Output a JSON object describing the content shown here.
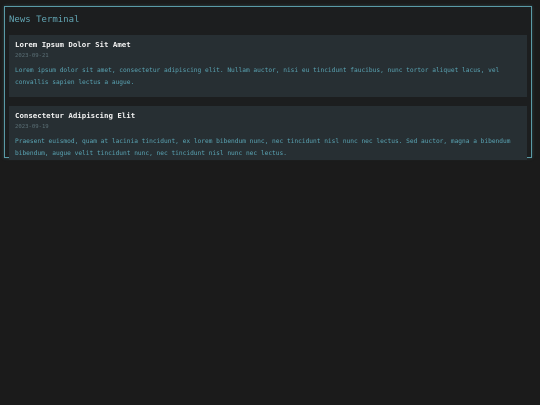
{
  "terminal": {
    "title": "News Terminal"
  },
  "articles": [
    {
      "title": "Lorem Ipsum Dolor Sit Amet",
      "date": "2023-09-21",
      "body": "Lorem ipsum dolor sit amet, consectetur adipiscing elit. Nullam auctor, nisi eu tincidunt faucibus, nunc tortor aliquet lacus, vel convallis sapien lectus a augue."
    },
    {
      "title": "Consectetur Adipiscing Elit",
      "date": "2023-09-19",
      "body": "Praesent euismod, quam at lacinia tincidunt, ex lorem bibendum nunc, nec tincidunt nisl nunc nec lectus. Sed auctor, magna a bibendum bibendum, augue velit tincidunt nunc, nec tincidunt nisl nunc nec lectus."
    }
  ],
  "colors": {
    "background": "#1b1b1b",
    "border": "#5a9aa6",
    "accent": "#62a5b3",
    "card": "#272f33",
    "heading": "#f2f2f2",
    "date": "#5b7077",
    "body": "#5aa5b5"
  }
}
